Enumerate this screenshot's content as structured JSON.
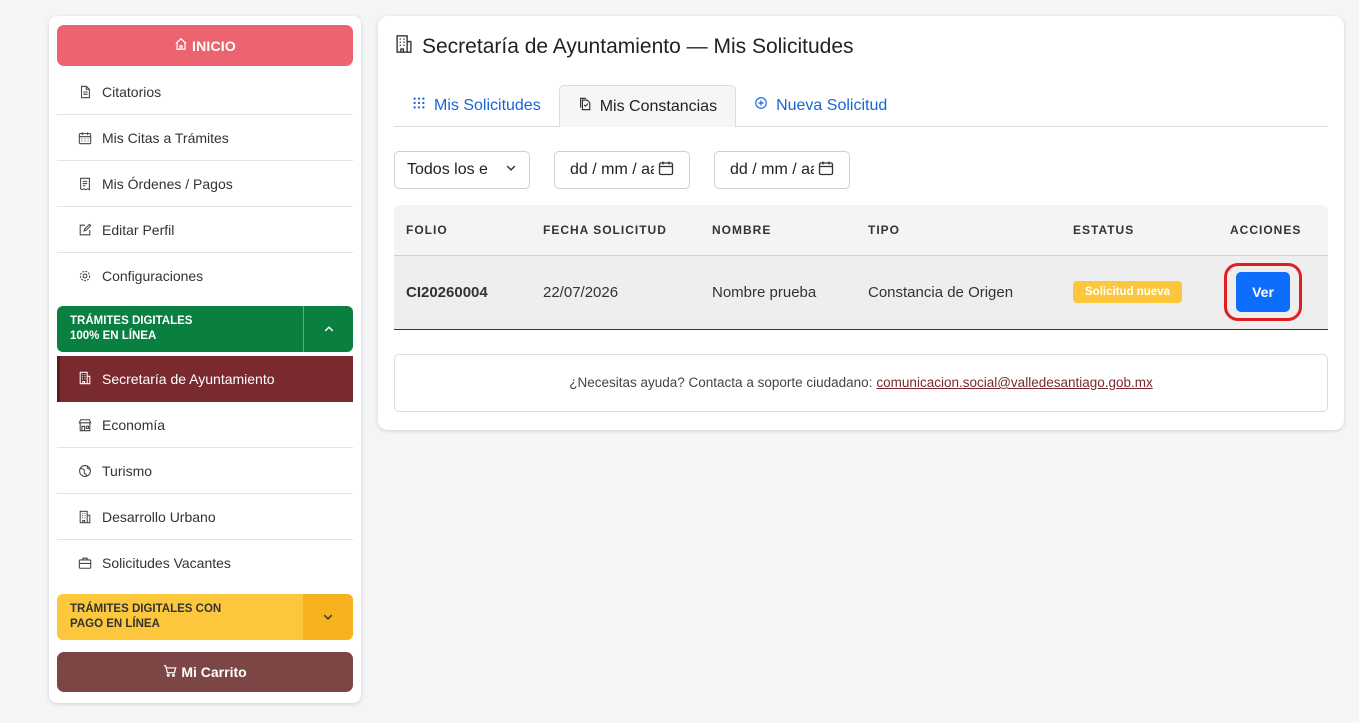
{
  "sidebar": {
    "inicio_label": "INICIO",
    "items": [
      {
        "label": "Citatorios",
        "icon": "file-text-icon"
      },
      {
        "label": "Mis Citas a Trámites",
        "icon": "calendar-icon"
      },
      {
        "label": "Mis Órdenes / Pagos",
        "icon": "receipt-icon"
      },
      {
        "label": "Editar Perfil",
        "icon": "edit-icon"
      },
      {
        "label": "Configuraciones",
        "icon": "gear-icon"
      }
    ],
    "green_group": {
      "label": "TRÁMITES DIGITALES 100% EN LÍNEA",
      "line1": "TRÁMITES DIGITALES",
      "line2": "100% EN LÍNEA",
      "toggle_icon": "chevron-up-icon",
      "color": "#0a8040"
    },
    "active_item": {
      "label": "Secretaría de Ayuntamiento",
      "icon": "building-icon",
      "color": "#7a2a2e"
    },
    "sub_items": [
      {
        "label": "Economía",
        "icon": "store-icon"
      },
      {
        "label": "Turismo",
        "icon": "globe-icon"
      },
      {
        "label": "Desarrollo Urbano",
        "icon": "building-icon"
      },
      {
        "label": "Solicitudes Vacantes",
        "icon": "briefcase-icon"
      }
    ],
    "yellow_group": {
      "line1": "TRÁMITES DIGITALES CON",
      "line2": "PAGO EN LÍNEA",
      "toggle_icon": "chevron-down-icon",
      "color": "#fcc73d"
    },
    "cart_label": "Mi Carrito"
  },
  "main": {
    "title": "Secretaría de Ayuntamiento — Mis Solicitudes",
    "tabs": [
      {
        "label": "Mis Solicitudes",
        "icon": "grid-dots-icon",
        "active": false
      },
      {
        "label": "Mis Constancias",
        "icon": "files-icon",
        "active": true
      },
      {
        "label": "Nueva Solicitud",
        "icon": "plus-circle-icon",
        "active": false
      }
    ],
    "filters": {
      "status_select": "Todos los e",
      "date_from": "dd / mm / aa",
      "date_to": "dd / mm / aa"
    },
    "table": {
      "headers": [
        "FOLIO",
        "FECHA SOLICITUD",
        "NOMBRE",
        "TIPO",
        "ESTATUS",
        "ACCIONES"
      ],
      "rows": [
        {
          "folio": "CI20260004",
          "fecha": "22/07/2026",
          "nombre": "Nombre prueba",
          "tipo": "Constancia de Origen",
          "estatus": "Solicitud nueva",
          "accion": "Ver"
        }
      ]
    },
    "help": {
      "text": "¿Necesitas ayuda? Contacta a soporte ciudadano:",
      "email": "comunicacion.social@valledesantiago.gob.mx"
    }
  },
  "colors": {
    "inicio": "#ec6470",
    "carrito": "#7b4644",
    "link": "#1565d8",
    "ver_button": "#0d6efd",
    "highlight_ring": "#e02020"
  }
}
